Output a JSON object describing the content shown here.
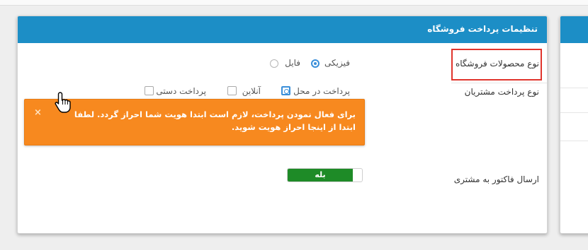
{
  "panel": {
    "title": "تنظیمات پرداخت فروشگاه"
  },
  "product_type": {
    "label": "نوع محصولات فروشگاه",
    "options": [
      {
        "label": "فیزیکی",
        "checked": true
      },
      {
        "label": "فایل",
        "checked": false
      }
    ]
  },
  "payment_type": {
    "label": "نوع پرداخت مشتریان",
    "options": [
      {
        "label": "پرداخت در محل",
        "checked": true
      },
      {
        "label": "آنلاین",
        "checked": false
      },
      {
        "label": "پرداخت دستی",
        "checked": false
      }
    ]
  },
  "alert": {
    "message": "برای فعال نمودن پرداخت، لازم است ابتدا هویت شما احراز گردد. لطفا ابتدا از اینجا احراز هویت شوید.",
    "close_icon": "×"
  },
  "invoice": {
    "label": "ارسال فاکتور به مشتری",
    "toggle_label": "بله",
    "toggle_on": true
  },
  "colors": {
    "header": "#1c8ec6",
    "alert": "#f7891f",
    "toggle_on": "#1e8b27",
    "highlight": "#e0342c"
  }
}
